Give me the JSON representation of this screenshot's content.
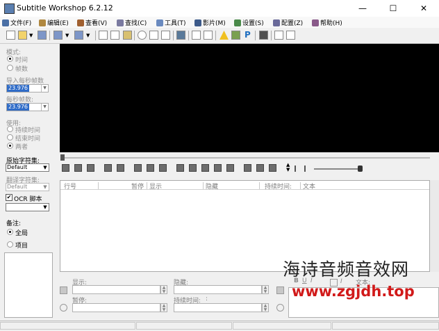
{
  "window": {
    "title": "Subtitle Workshop 6.2.12",
    "minimize": "—",
    "maximize": "☐",
    "close": "✕"
  },
  "menu": [
    {
      "label": "文件(F)",
      "icon": "file-icon"
    },
    {
      "label": "编辑(E)",
      "icon": "edit-icon"
    },
    {
      "label": "查看(V)",
      "icon": "eye-icon"
    },
    {
      "label": "查找(C)",
      "icon": "search-icon"
    },
    {
      "label": "工具(T)",
      "icon": "wrench-icon"
    },
    {
      "label": "影片(M)",
      "icon": "film-icon"
    },
    {
      "label": "设置(S)",
      "icon": "settings-icon"
    },
    {
      "label": "配置(Z)",
      "icon": "config-icon"
    },
    {
      "label": "帮助(H)",
      "icon": "help-icon"
    }
  ],
  "left": {
    "mode_label": "模式:",
    "mode_time": "时间",
    "mode_frames": "帧数",
    "input_fps_label": "导入每秒帧数",
    "input_fps_value": "23.976",
    "fps_label": "每秒帧数:",
    "fps_value": "23.976",
    "use_label": "使用:",
    "use_duration": "持续时间",
    "use_end": "结束时间",
    "use_both": "两者",
    "orig_charset_label": "原始字符集:",
    "orig_charset_value": "Default",
    "trans_charset_label": "翻译字符集:",
    "trans_charset_value": "Default",
    "ocr_label": "OCR 脚本",
    "notes_label": "备注:",
    "notes_global": "全局",
    "notes_item": "项目"
  },
  "grid": {
    "columns": [
      "行号",
      "暂停",
      "显示",
      "隐藏",
      "持续时间:",
      "文本"
    ]
  },
  "editor": {
    "show_label": "显示:",
    "hide_label": "隐藏:",
    "pause_label": "暂停:",
    "duration_label": "持续时间:",
    "duration_value": ":",
    "text_label": "文本:",
    "fmt_bold": "B",
    "fmt_underline": "U",
    "fmt_italic": "I"
  },
  "watermark": {
    "line1": "海诗音频音效网",
    "line2": "www.zgjdh.top"
  },
  "colors": {
    "video_bg": "#000000",
    "selection": "#2f6cc8",
    "watermark_url": "#d11a1a"
  }
}
